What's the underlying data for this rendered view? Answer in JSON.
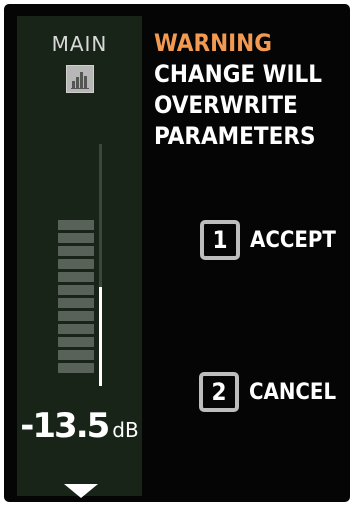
{
  "strip": {
    "label": "MAIN",
    "icon": "bar-graph-icon",
    "level_value": "-13.5",
    "level_unit": "dB",
    "meter_fraction": 0.41,
    "segment_count": 12,
    "arrow_icon": "triangle-down-icon"
  },
  "dialog": {
    "warning_title": "WARNING",
    "lines": [
      "CHANGE WILL",
      "OVERWRITE",
      "PARAMETERS"
    ]
  },
  "options": [
    {
      "key": "1",
      "label": "ACCEPT"
    },
    {
      "key": "2",
      "label": "CANCEL"
    }
  ],
  "colors": {
    "warning": "#f39a52",
    "strip_bg": "#172417",
    "key_border": "#bdbdbd"
  }
}
